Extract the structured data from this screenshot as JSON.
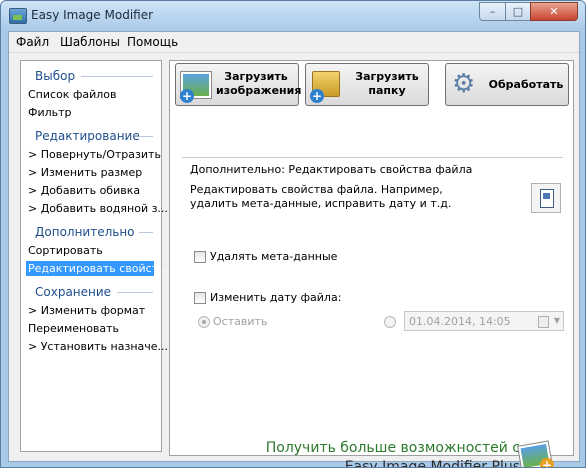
{
  "window": {
    "title": "Easy Image Modifier",
    "controls": {
      "minimize": "–",
      "maximize": "□",
      "close": "✕"
    }
  },
  "menu": [
    "Файл",
    "Шаблоны",
    "Помощь"
  ],
  "sidebar": {
    "sections": [
      {
        "title": "Выбор",
        "items": [
          "Список файлов",
          "Фильтр"
        ]
      },
      {
        "title": "Редактирование",
        "items": [
          "> Повернуть/Отразить",
          "> Изменить размер",
          "> Добавить обивка",
          "> Добавить водяной з..."
        ]
      },
      {
        "title": "Дополнительно",
        "items": [
          "Сортировать",
          "Редактировать свойст..."
        ]
      },
      {
        "title": "Сохранение",
        "items": [
          "> Изменить формат",
          "Переименовать",
          "> Установить назначе..."
        ]
      }
    ],
    "selected": "Редактировать свойст..."
  },
  "toolbar": {
    "load_images": "Загрузить\nизображения",
    "load_folder": "Загрузить\nпапку",
    "process": "Обработать"
  },
  "panel": {
    "title": "Дополнительно: Редактировать свойства файла",
    "description": "Редактировать свойства файла. Например, удалить мета-данные, исправить дату и т.д.",
    "remove_metadata": {
      "label": "Удалять мета-данные",
      "checked": false
    },
    "change_date": {
      "label": "Изменить дату файла:",
      "checked": false
    },
    "keep_option": {
      "label": "Оставить",
      "selected": true
    },
    "date_value": "01.04.2014, 14:05"
  },
  "promo": {
    "line1": "Получить больше возможностей с",
    "line2": "Easy Image Modifier Plus"
  },
  "colors": {
    "section_header": "#1f4e8c",
    "selection": "#3399ff",
    "promo_green": "#2c7a2c"
  }
}
